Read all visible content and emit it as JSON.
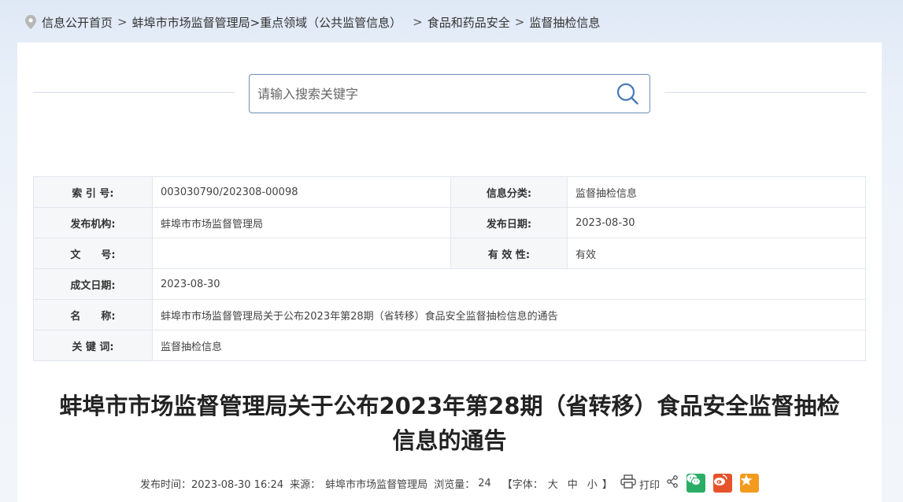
{
  "breadcrumb": {
    "items": [
      "信息公开首页",
      "蚌埠市市场监督管理局>重点领域（公共监管信息）",
      "食品和药品安全",
      "监督抽检信息"
    ],
    "separator": ">"
  },
  "search": {
    "placeholder": "请输入搜索关键字"
  },
  "meta": {
    "index_label": "索 引 号:",
    "index_value": "003030790/202308-00098",
    "category_label": "信息分类:",
    "category_value": "监督抽检信息",
    "org_label": "发布机构:",
    "org_value": "蚌埠市市场监督管理局",
    "pubdate_label": "发布日期:",
    "pubdate_value": "2023-08-30",
    "docno_label": "文　　号:",
    "docno_value": "",
    "validity_label": "有 效 性:",
    "validity_value": "有效",
    "created_label": "成文日期:",
    "created_value": "2023-08-30",
    "name_label": "名　　称:",
    "name_value": "蚌埠市市场监督管理局关于公布2023年第28期（省转移）食品安全监督抽检信息的通告",
    "keywords_label": "关 键 词:",
    "keywords_value": "监督抽检信息"
  },
  "article": {
    "title_line1": "蚌埠市市场监督管理局关于公布2023年第28期（省转移）食品安全监督抽检",
    "title_line2": "信息的通告"
  },
  "info_bar": {
    "time_label": "发布时间：2023-08-30 16:24",
    "source_label": "来源：",
    "source_value": "蚌埠市市场监督管理局",
    "views_label": "浏览量：",
    "views_value": "24",
    "font_label": "【字体：",
    "font_large": "大",
    "font_medium": "中",
    "font_small": "小",
    "font_close": "】",
    "print_label": "打印"
  },
  "colors": {
    "wechat": "#2aae67",
    "weibo": "#e6532b",
    "favorite": "#f39b1e",
    "search_border": "#6f8fb8"
  },
  "icons": [
    "location-icon",
    "search-icon",
    "print-icon",
    "share-icon",
    "wechat-icon",
    "weibo-icon",
    "star-icon"
  ]
}
